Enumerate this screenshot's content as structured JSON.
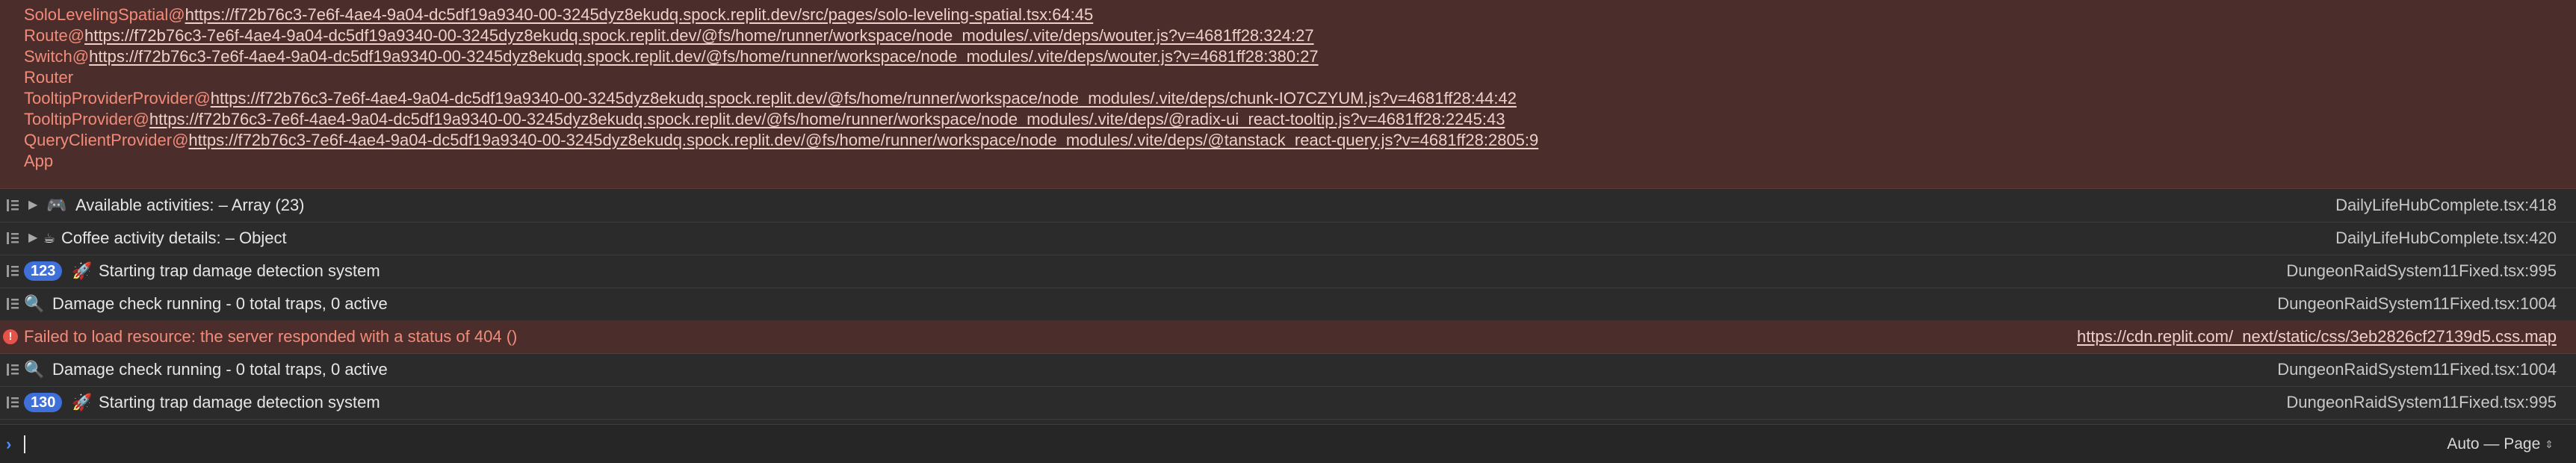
{
  "stack": [
    {
      "fn": "SoloLevelingSpatial@",
      "url": "https://f72b76c3-7e6f-4ae4-9a04-dc5df19a9340-00-3245dyz8ekudq.spock.replit.dev/src/pages/solo-leveling-spatial.tsx:64:45"
    },
    {
      "fn": "Route@",
      "url": "https://f72b76c3-7e6f-4ae4-9a04-dc5df19a9340-00-3245dyz8ekudq.spock.replit.dev/@fs/home/runner/workspace/node_modules/.vite/deps/wouter.js?v=4681ff28:324:27"
    },
    {
      "fn": "Switch@",
      "url": "https://f72b76c3-7e6f-4ae4-9a04-dc5df19a9340-00-3245dyz8ekudq.spock.replit.dev/@fs/home/runner/workspace/node_modules/.vite/deps/wouter.js?v=4681ff28:380:27"
    },
    {
      "fn": "Router",
      "url": ""
    },
    {
      "fn": "TooltipProviderProvider@",
      "url": "https://f72b76c3-7e6f-4ae4-9a04-dc5df19a9340-00-3245dyz8ekudq.spock.replit.dev/@fs/home/runner/workspace/node_modules/.vite/deps/chunk-IO7CZYUM.js?v=4681ff28:44:42"
    },
    {
      "fn": "TooltipProvider@",
      "url": "https://f72b76c3-7e6f-4ae4-9a04-dc5df19a9340-00-3245dyz8ekudq.spock.replit.dev/@fs/home/runner/workspace/node_modules/.vite/deps/@radix-ui_react-tooltip.js?v=4681ff28:2245:43"
    },
    {
      "fn": "QueryClientProvider@",
      "url": "https://f72b76c3-7e6f-4ae4-9a04-dc5df19a9340-00-3245dyz8ekudq.spock.replit.dev/@fs/home/runner/workspace/node_modules/.vite/deps/@tanstack_react-query.js?v=4681ff28:2805:9"
    },
    {
      "fn": "App",
      "url": ""
    }
  ],
  "logs": [
    {
      "emoji": "🎮",
      "message": "Available activities: – Array (23)",
      "source": "DailyLifeHubComplete.tsx:418"
    },
    {
      "emoji": "☕",
      "message": "Coffee activity details: – Object",
      "source": "DailyLifeHubComplete.tsx:420"
    },
    {
      "badge": "123",
      "emoji": "🚀",
      "message": "Starting trap damage detection system",
      "source": "DungeonRaidSystem11Fixed.tsx:995"
    },
    {
      "emoji": "🔍",
      "message": "Damage check running - 0 total traps, 0 active",
      "source": "DungeonRaidSystem11Fixed.tsx:1004"
    },
    {
      "message": "Failed to load resource: the server responded with a status of 404 ()",
      "source": "https://cdn.replit.com/_next/static/css/3eb2826cf27139d5.css.map"
    },
    {
      "emoji": "🔍",
      "message": "Damage check running - 0 total traps, 0 active",
      "source": "DungeonRaidSystem11Fixed.tsx:1004"
    },
    {
      "badge": "130",
      "emoji": "🚀",
      "message": "Starting trap damage detection system",
      "source": "DungeonRaidSystem11Fixed.tsx:995"
    }
  ],
  "prompt": {
    "input_value": "",
    "context_label": "Auto — Page"
  },
  "icons": {
    "group_icon": "console-group-icon",
    "disclosure": "disclosure-triangle-icon",
    "error_icon": "error-icon",
    "prompt": "prompt-chevron-icon",
    "select_chevron": "up-down-chevron-icon"
  },
  "colors": {
    "background": "#2b2b2b",
    "error_background": "#4b2e2b",
    "error_text": "#f28b79",
    "badge": "#3f6fd8",
    "prompt_accent": "#4c8dfc"
  }
}
